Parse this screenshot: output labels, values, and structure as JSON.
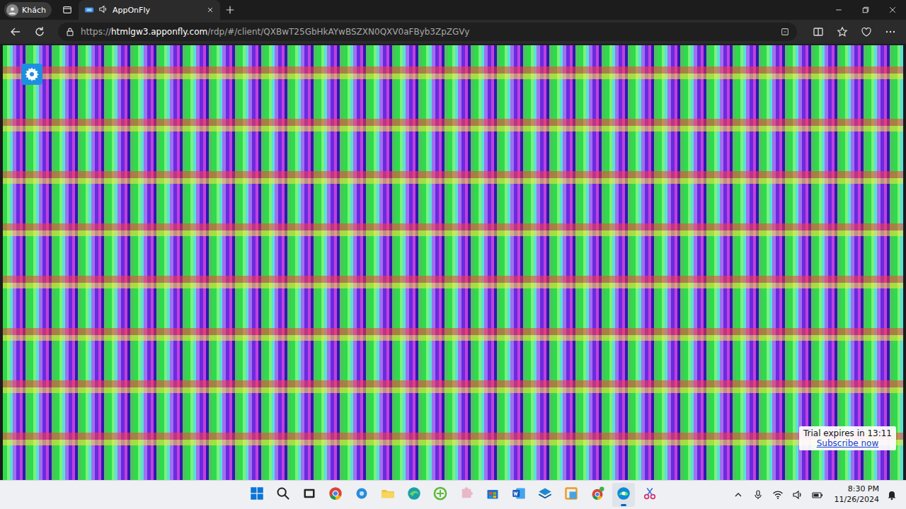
{
  "browser": {
    "profile": "Khách",
    "tabs": [
      {
        "label": "AppOnFly",
        "selected": true,
        "audible": true
      }
    ],
    "address": {
      "scheme": "https://",
      "host": "htmlgw3.apponfly.com",
      "path": "/rdp/#/client/QXBwT25GbHkAYwBSZXN0QXV0aFByb3ZpZGVy"
    }
  },
  "trial": {
    "text": "Trial expires in 13:11",
    "link": "Subscribe now"
  },
  "taskbar": {
    "apps": [
      {
        "kind": "start",
        "active": false
      },
      {
        "kind": "search",
        "active": false
      },
      {
        "kind": "taskview",
        "active": false
      },
      {
        "kind": "chrome",
        "active": false
      },
      {
        "kind": "bluegear",
        "active": false
      },
      {
        "kind": "explorer",
        "active": false
      },
      {
        "kind": "edgeglobe",
        "active": false
      },
      {
        "kind": "greenleaf",
        "active": false
      },
      {
        "kind": "puzzle",
        "active": false
      },
      {
        "kind": "store",
        "active": false
      },
      {
        "kind": "word",
        "active": false
      },
      {
        "kind": "layers",
        "active": false
      },
      {
        "kind": "orangebox",
        "active": false
      },
      {
        "kind": "chromebadge",
        "active": false
      },
      {
        "kind": "edge",
        "active": true
      },
      {
        "kind": "snip",
        "active": false
      }
    ],
    "clock": {
      "time": "8:30 PM",
      "date": "11/26/2024"
    }
  }
}
